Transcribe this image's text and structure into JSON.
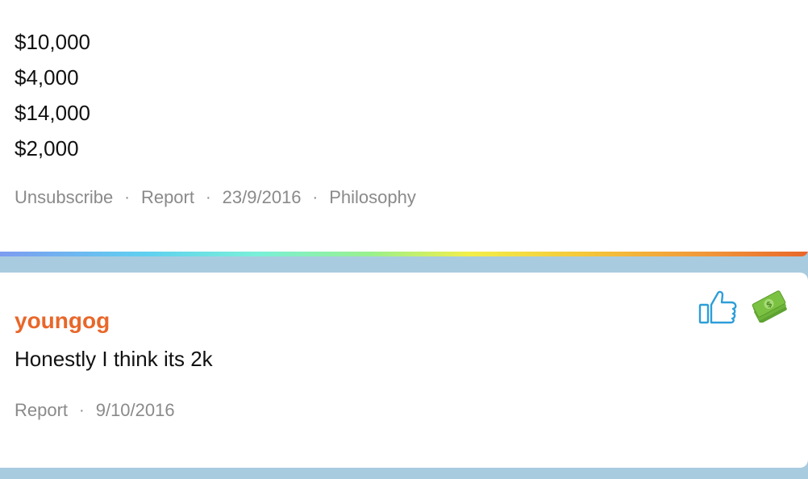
{
  "question": {
    "options": [
      "$10,000",
      "$4,000",
      "$14,000",
      "$2,000"
    ],
    "meta": {
      "unsubscribe": "Unsubscribe",
      "report": "Report",
      "date": "23/9/2016",
      "category": "Philosophy"
    }
  },
  "answer": {
    "username": "youngog",
    "text": "Honestly I think its 2k",
    "meta": {
      "report": "Report",
      "date": "9/10/2016"
    },
    "icons": {
      "like": "thumbs-up-icon",
      "tip": "money-icon"
    }
  },
  "colors": {
    "username": "#e8672a",
    "like_icon": "#2d9ed8",
    "money_icon": "#7cc242",
    "meta_text": "#8a8a8a",
    "background": "#a9cbe0"
  },
  "separator": "·"
}
